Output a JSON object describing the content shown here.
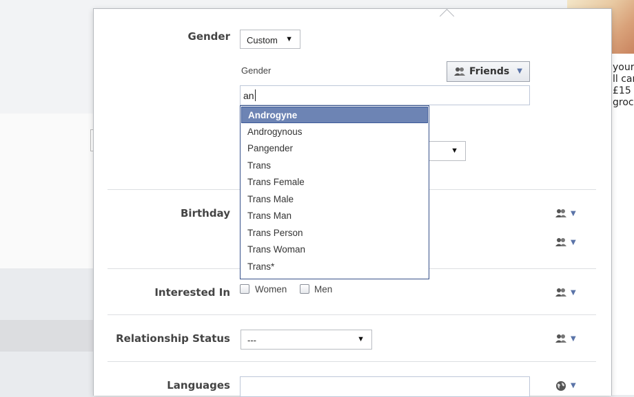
{
  "ad": {
    "text_lines": [
      "your",
      "ll car",
      "£15",
      "groc"
    ]
  },
  "gender": {
    "label": "Gender",
    "select_value": "Custom",
    "sub_label": "Gender",
    "input_value": "an",
    "audience": "Friends",
    "suggestions": [
      "Androgyne",
      "Androgynous",
      "Pangender",
      "Trans",
      "Trans Female",
      "Trans Male",
      "Trans Man",
      "Trans Person",
      "Trans Woman",
      "Trans*"
    ],
    "selected_suggestion": "Androgyne"
  },
  "birthday": {
    "label": "Birthday"
  },
  "interested_in": {
    "label": "Interested In",
    "options": [
      "Women",
      "Men"
    ]
  },
  "relationship": {
    "label": "Relationship Status",
    "value": "---"
  },
  "languages": {
    "label": "Languages",
    "value": ""
  },
  "colors": {
    "accent": "#6d84b4",
    "border_dark": "#354f89",
    "link_blue": "#5b74a8"
  }
}
